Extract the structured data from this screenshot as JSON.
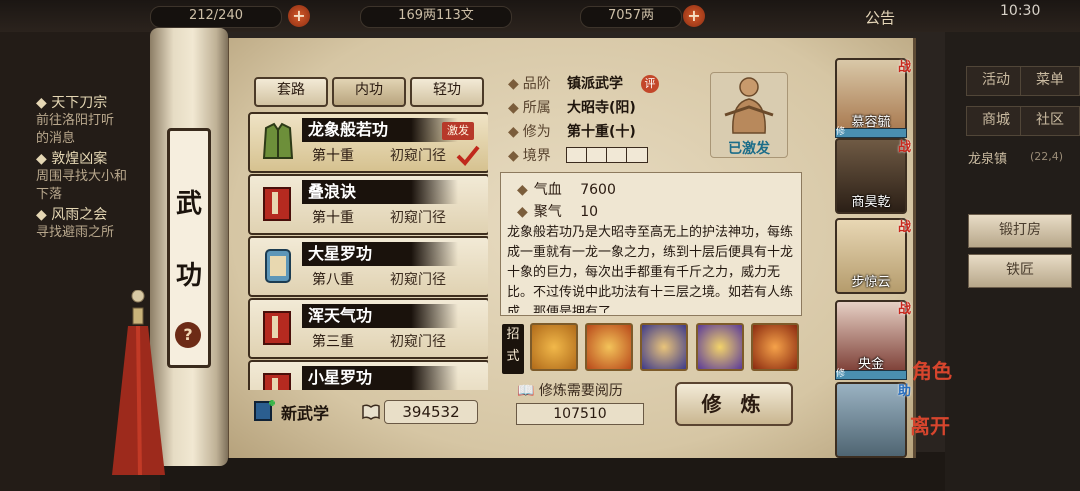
{
  "topbar": {
    "stamina": "212/240",
    "silver": "169两113文",
    "gold": "7057两",
    "announce": "公告",
    "time": "10:30"
  },
  "quests": [
    {
      "title": "天下刀宗",
      "desc1": "前往洛阳打听",
      "desc2": "的消息"
    },
    {
      "title": "敦煌凶案",
      "desc1": "周围寻找大小和",
      "desc2": "下落"
    },
    {
      "title": "风雨之会",
      "desc1": "寻找避雨之所",
      "desc2": ""
    }
  ],
  "right_menu": {
    "b1": "活动",
    "b2": "菜单",
    "b3": "商城",
    "b4": "社区",
    "location": "龙泉镇",
    "coords": "(22,4)",
    "forge": "锻打房",
    "smith": "铁匠"
  },
  "scroll_title": [
    "武",
    "功"
  ],
  "help": "?",
  "tabs": [
    "套路",
    "内功",
    "轻功"
  ],
  "skills": [
    {
      "name": "龙象般若功",
      "level": "第十重",
      "rank": "初窥门径",
      "badge": "激发"
    },
    {
      "name": "叠浪诀",
      "level": "第十重",
      "rank": "初窥门径"
    },
    {
      "name": "大星罗功",
      "level": "第八重",
      "rank": "初窥门径"
    },
    {
      "name": "浑天气功",
      "level": "第三重",
      "rank": "初窥门径"
    },
    {
      "name": "小星罗功",
      "level": "",
      "rank": ""
    }
  ],
  "new_skill": "新武学",
  "book_count": "394532",
  "info": {
    "grade_label": "品阶",
    "grade": "镇派武学",
    "ping": "评",
    "sect_label": "所属",
    "sect": "大昭寺(阳)",
    "level_label": "修为",
    "level": "第十重(十)",
    "realm_label": "境界",
    "activated": "已激发"
  },
  "stats": {
    "hp_label": "气血",
    "hp": "7600",
    "qi_label": "聚气",
    "qi": "10",
    "desc": "龙象般若功乃是大昭寺至高无上的护法神功，每练成一重就有一龙一象之力，练到十层后便具有十龙十象的巨力，每次出手都重有千斤之力，威力无比。不过传说中此功法有十三层之境。如若有人练成，那便是拥有了"
  },
  "moves_label": "招式",
  "train": {
    "req_label": "修炼需要阅历",
    "req_value": "107510",
    "button": "修 炼"
  },
  "characters": [
    {
      "name": "慕容毓"
    },
    {
      "name": "商昊乾"
    },
    {
      "name": "步惊云"
    },
    {
      "name": "央金"
    },
    {
      "name": ""
    }
  ],
  "char_side": {
    "zhan": "战",
    "xiu": "修",
    "zhu": "助",
    "role": "角色",
    "leave": "离开"
  },
  "colors": {
    "accent_red": "#c8281d",
    "paper": "#e2d4b6",
    "ink": "#1a120c",
    "activated": "#1c6d89"
  }
}
